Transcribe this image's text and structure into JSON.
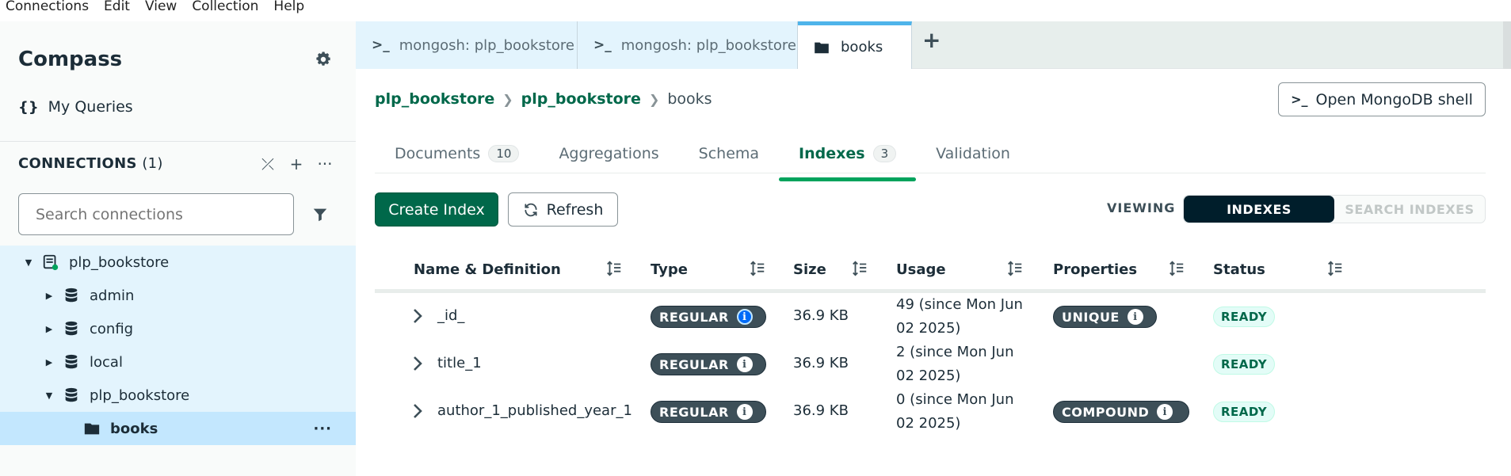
{
  "menu": [
    "Connections",
    "Edit",
    "View",
    "Collection",
    "Help"
  ],
  "sidebar": {
    "brand": "Compass",
    "my_queries": "My Queries",
    "my_queries_icon": "{}",
    "connections_label": "CONNECTIONS",
    "connections_count": "(1)",
    "search_placeholder": "Search connections",
    "tree": [
      {
        "label": "plp_bookstore",
        "kind": "connection",
        "expanded": true
      },
      {
        "label": "admin",
        "kind": "database",
        "expanded": false
      },
      {
        "label": "config",
        "kind": "database",
        "expanded": false
      },
      {
        "label": "local",
        "kind": "database",
        "expanded": false
      },
      {
        "label": "plp_bookstore",
        "kind": "database",
        "expanded": true
      },
      {
        "label": "books",
        "kind": "collection",
        "selected": true
      }
    ]
  },
  "tabs": [
    {
      "label": "mongosh: plp_bookstore",
      "prefix": ">_"
    },
    {
      "label": "mongosh: plp_bookstore",
      "prefix": ">_"
    },
    {
      "label": "books",
      "active": true
    }
  ],
  "breadcrumb": [
    "plp_bookstore",
    "plp_bookstore",
    "books"
  ],
  "open_shell_label": "Open MongoDB shell",
  "open_shell_prefix": ">_",
  "subtabs": [
    {
      "label": "Documents",
      "count": "10"
    },
    {
      "label": "Aggregations"
    },
    {
      "label": "Schema"
    },
    {
      "label": "Indexes",
      "count": "3",
      "active": true
    },
    {
      "label": "Validation"
    }
  ],
  "toolbar": {
    "create_index": "Create Index",
    "refresh": "Refresh",
    "viewing": "VIEWING",
    "indexes": "INDEXES",
    "search_indexes": "SEARCH INDEXES"
  },
  "table": {
    "headers": [
      "Name & Definition",
      "Type",
      "Size",
      "Usage",
      "Properties",
      "Status"
    ],
    "rows": [
      {
        "name": "_id_",
        "type": "REGULAR",
        "size": "36.9 KB",
        "usage_line1": "49 (since Mon Jun",
        "usage_line2": "02 2025)",
        "property": "UNIQUE",
        "status": "READY"
      },
      {
        "name": "title_1",
        "type": "REGULAR",
        "size": "36.9 KB",
        "usage_line1": "2 (since Mon Jun",
        "usage_line2": "02 2025)",
        "property": "",
        "status": "READY"
      },
      {
        "name": "author_1_published_year_1",
        "type": "REGULAR",
        "size": "36.9 KB",
        "usage_line1": "0 (since Mon Jun",
        "usage_line2": "02 2025)",
        "property": "COMPOUND",
        "status": "READY"
      }
    ]
  },
  "colors": {
    "accent_green": "#00684a",
    "tab_active_border": "#4fb4ea",
    "sidebar_selected": "#c3e7fe"
  }
}
